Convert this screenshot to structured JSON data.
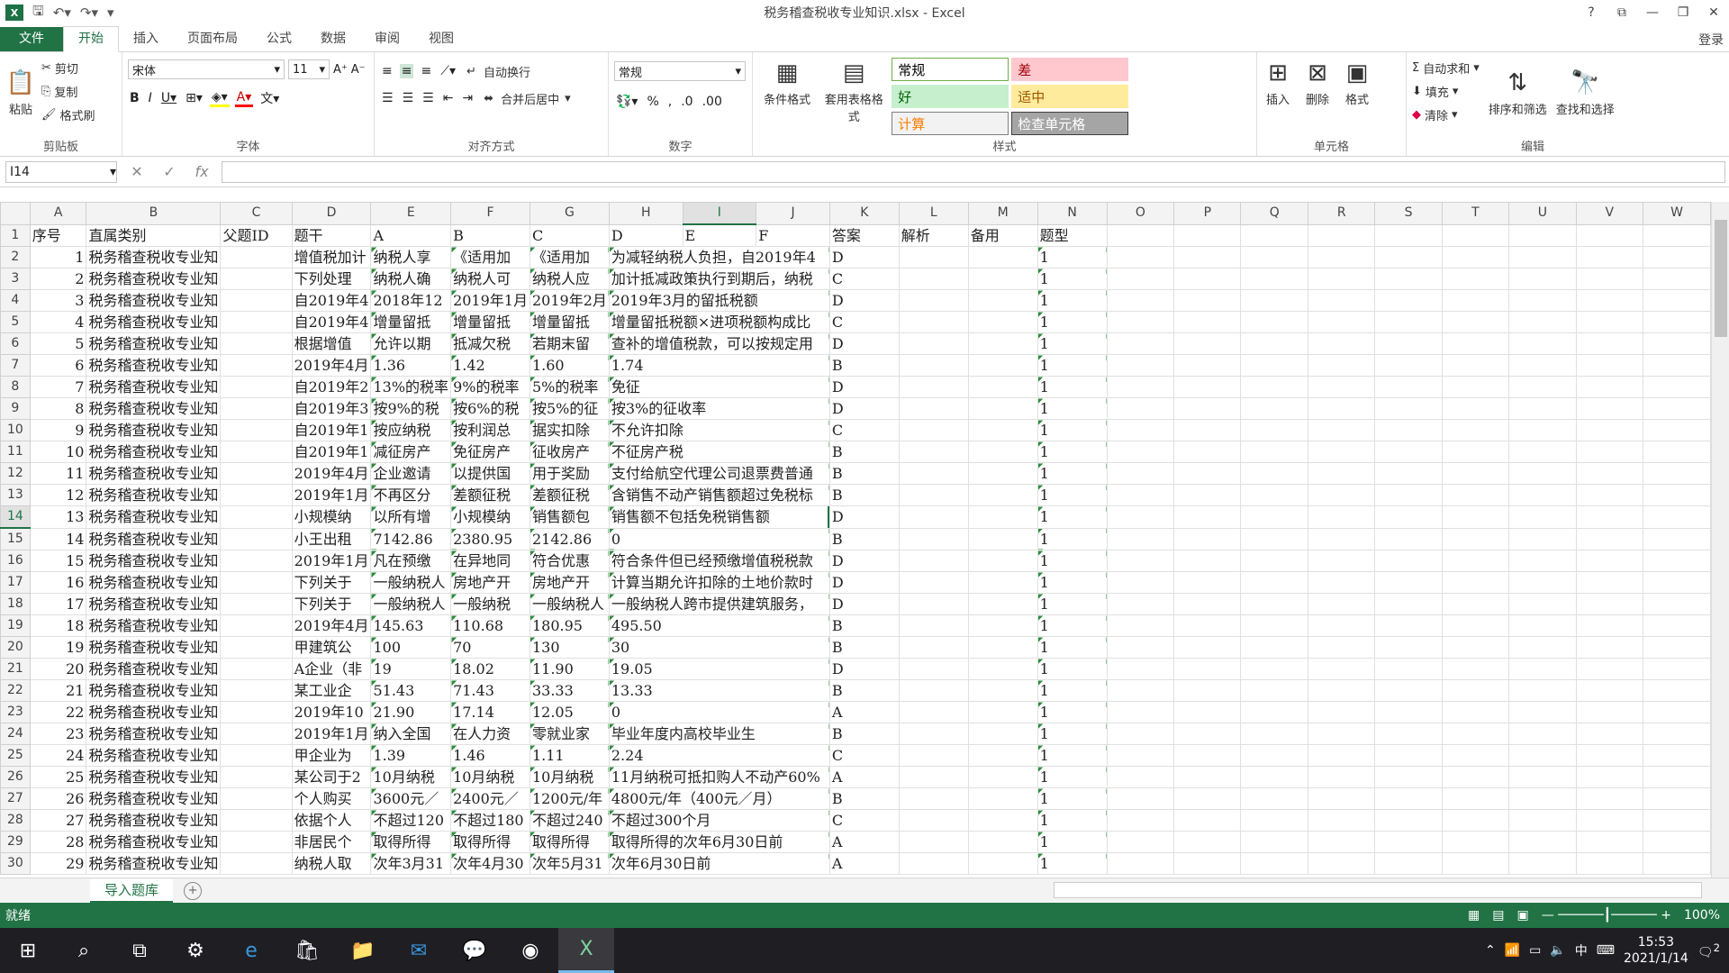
{
  "title": "税务稽查税收专业知识.xlsx - Excel",
  "login": "登录",
  "tabs": [
    "文件",
    "开始",
    "插入",
    "页面布局",
    "公式",
    "数据",
    "审阅",
    "视图"
  ],
  "ribbon": {
    "paste": "粘贴",
    "cut": "剪切",
    "copy": "复制",
    "format_painter": "格式刷",
    "clipboard_label": "剪贴板",
    "font_name": "宋体",
    "font_size": "11",
    "font_label": "字体",
    "wrap": "自动换行",
    "merge": "合并后居中",
    "align_label": "对齐方式",
    "number_format": "常规",
    "number_label": "数字",
    "cond_format": "条件格式",
    "table_format": "套用表格格式",
    "styles_label": "样式",
    "styles": [
      {
        "label": "常规",
        "bg": "#ffffff",
        "fg": "#000000",
        "border": "#70ad47"
      },
      {
        "label": "差",
        "bg": "#ffc7ce",
        "fg": "#9c0006",
        "border": "#ffc7ce"
      },
      {
        "label": "好",
        "bg": "#c6efce",
        "fg": "#006100",
        "border": "#c6efce"
      },
      {
        "label": "适中",
        "bg": "#ffeb9c",
        "fg": "#9c5700",
        "border": "#ffeb9c"
      },
      {
        "label": "计算",
        "bg": "#f2f2f2",
        "fg": "#fa7d00",
        "border": "#7f7f7f"
      },
      {
        "label": "检查单元格",
        "bg": "#a5a5a5",
        "fg": "#ffffff",
        "border": "#3f3f3f"
      }
    ],
    "insert": "插入",
    "delete": "删除",
    "format": "格式",
    "cells_label": "单元格",
    "autosum": "自动求和",
    "fill": "填充",
    "clear": "清除",
    "sort_filter": "排序和筛选",
    "find_select": "查找和选择",
    "edit_label": "编辑"
  },
  "namebox": "I14",
  "columns": [
    "A",
    "B",
    "C",
    "D",
    "E",
    "F",
    "G",
    "H",
    "I",
    "J",
    "K",
    "L",
    "M",
    "N",
    "O",
    "P",
    "Q",
    "R",
    "S",
    "T",
    "U",
    "V",
    "W"
  ],
  "header_row": [
    "序号",
    "直属类别",
    "父题ID",
    "题干",
    "A",
    "B",
    "C",
    "D",
    "E",
    "F",
    "答案",
    "解析",
    "备用",
    "题型"
  ],
  "rows": [
    [
      "1",
      "税务稽查税收专业知",
      "增值税加计",
      "纳税人享",
      "《适用加",
      "《适用加",
      "为减轻纳税人负担，自2019年4",
      "D",
      "1"
    ],
    [
      "2",
      "税务稽查税收专业知",
      "下列处理",
      "纳税人确",
      "纳税人可",
      "纳税人应",
      "加计抵减政策执行到期后，纳税",
      "C",
      "1"
    ],
    [
      "3",
      "税务稽查税收专业知",
      "自2019年4",
      "2018年12",
      "2019年1月",
      "2019年2月",
      "2019年3月的留抵税额",
      "D",
      "1"
    ],
    [
      "4",
      "税务稽查税收专业知",
      "自2019年4",
      "增量留抵",
      "增量留抵",
      "增量留抵",
      "增量留抵税额×进项税额构成比",
      "C",
      "1"
    ],
    [
      "5",
      "税务稽查税收专业知",
      "根据增值",
      "允许以期",
      "抵减欠税",
      "若期末留",
      "查补的增值税款，可以按规定用",
      "D",
      "1"
    ],
    [
      "6",
      "税务稽查税收专业知",
      "2019年4月",
      "1.36",
      "1.42",
      "1.60",
      "1.74",
      "B",
      "1"
    ],
    [
      "7",
      "税务稽查税收专业知",
      "自2019年2",
      "13%的税率",
      "9%的税率",
      "5%的税率",
      "免征",
      "D",
      "1"
    ],
    [
      "8",
      "税务稽查税收专业知",
      "自2019年3",
      "按9%的税",
      "按6%的税",
      "按5%的征",
      "按3%的征收率",
      "D",
      "1"
    ],
    [
      "9",
      "税务稽查税收专业知",
      "自2019年1",
      "按应纳税",
      "按利润总",
      "据实扣除",
      "不允许扣除",
      "C",
      "1"
    ],
    [
      "10",
      "税务稽查税收专业知",
      "自2019年1",
      "减征房产",
      "免征房产",
      "征收房产",
      "不征房产税",
      "B",
      "1"
    ],
    [
      "11",
      "税务稽查税收专业知",
      "2019年4月",
      "企业邀请",
      "以提供国",
      "用于奖励",
      "支付给航空代理公司退票费普通",
      "B",
      "1"
    ],
    [
      "12",
      "税务稽查税收专业知",
      "2019年1月",
      "不再区分",
      "差额征税",
      "差额征税",
      "含销售不动产销售额超过免税标",
      "B",
      "1"
    ],
    [
      "13",
      "税务稽查税收专业知",
      "小规模纳",
      "以所有增",
      "小规模纳",
      "销售额包",
      "销售额不包括免税销售额",
      "D",
      "1"
    ],
    [
      "14",
      "税务稽查税收专业知",
      "小王出租",
      "7142.86",
      "2380.95",
      "2142.86",
      "0",
      "B",
      "1"
    ],
    [
      "15",
      "税务稽查税收专业知",
      "2019年1月",
      "凡在预缴",
      "在异地同",
      "符合优惠",
      "符合条件但已经预缴增值税税款",
      "D",
      "1"
    ],
    [
      "16",
      "税务稽查税收专业知",
      "下列关于",
      "一般纳税人",
      "房地产开",
      "房地产开",
      "计算当期允许扣除的土地价款时",
      "D",
      "1"
    ],
    [
      "17",
      "税务稽查税收专业知",
      "下列关于",
      "一般纳税人",
      "一般纳税",
      "一般纳税人",
      "一般纳税人跨市提供建筑服务，",
      "D",
      "1"
    ],
    [
      "18",
      "税务稽查税收专业知",
      "2019年4月",
      "145.63",
      "110.68",
      "180.95",
      "495.50",
      "B",
      "1"
    ],
    [
      "19",
      "税务稽查税收专业知",
      "甲建筑公",
      "100",
      "70",
      "130",
      "30",
      "B",
      "1"
    ],
    [
      "20",
      "税务稽查税收专业知",
      "A企业（非",
      "19",
      "18.02",
      "11.90",
      "19.05",
      "D",
      "1"
    ],
    [
      "21",
      "税务稽查税收专业知",
      "某工业企",
      "51.43",
      "71.43",
      "33.33",
      "13.33",
      "B",
      "1"
    ],
    [
      "22",
      "税务稽查税收专业知",
      "2019年10",
      "21.90",
      "17.14",
      "12.05",
      "0",
      "A",
      "1"
    ],
    [
      "23",
      "税务稽查税收专业知",
      "2019年1月",
      "纳入全国",
      "在人力资",
      "零就业家",
      "毕业年度内高校毕业生",
      "B",
      "1"
    ],
    [
      "24",
      "税务稽查税收专业知",
      "甲企业为",
      "1.39",
      "1.46",
      "1.11",
      "2.24",
      "C",
      "1"
    ],
    [
      "25",
      "税务稽查税收专业知",
      "某公司于2",
      "10月纳税",
      "10月纳税",
      "10月纳税",
      "11月纳税可抵扣购人不动产60%",
      "A",
      "1"
    ],
    [
      "26",
      "税务稽查税收专业知",
      "个人购买",
      "3600元／",
      "2400元／",
      "1200元/年",
      "4800元/年（400元／月）",
      "B",
      "1"
    ],
    [
      "27",
      "税务稽查税收专业知",
      "依据个人",
      "不超过120",
      "不超过180",
      "不超过240",
      "不超过300个月",
      "C",
      "1"
    ],
    [
      "28",
      "税务稽查税收专业知",
      "非居民个",
      "取得所得",
      "取得所得",
      "取得所得",
      "取得所得的次年6月30日前",
      "A",
      "1"
    ],
    [
      "29",
      "税务稽查税收专业知",
      "纳税人取",
      "次年3月31",
      "次年4月30",
      "次年5月31",
      "次年6月30日前",
      "A",
      "1"
    ]
  ],
  "sheet_tab": "导入题库",
  "status": "就绪",
  "zoom": "100%",
  "clock_time": "15:53",
  "clock_date": "2021/1/14",
  "ime": "中",
  "notif_count": "2"
}
